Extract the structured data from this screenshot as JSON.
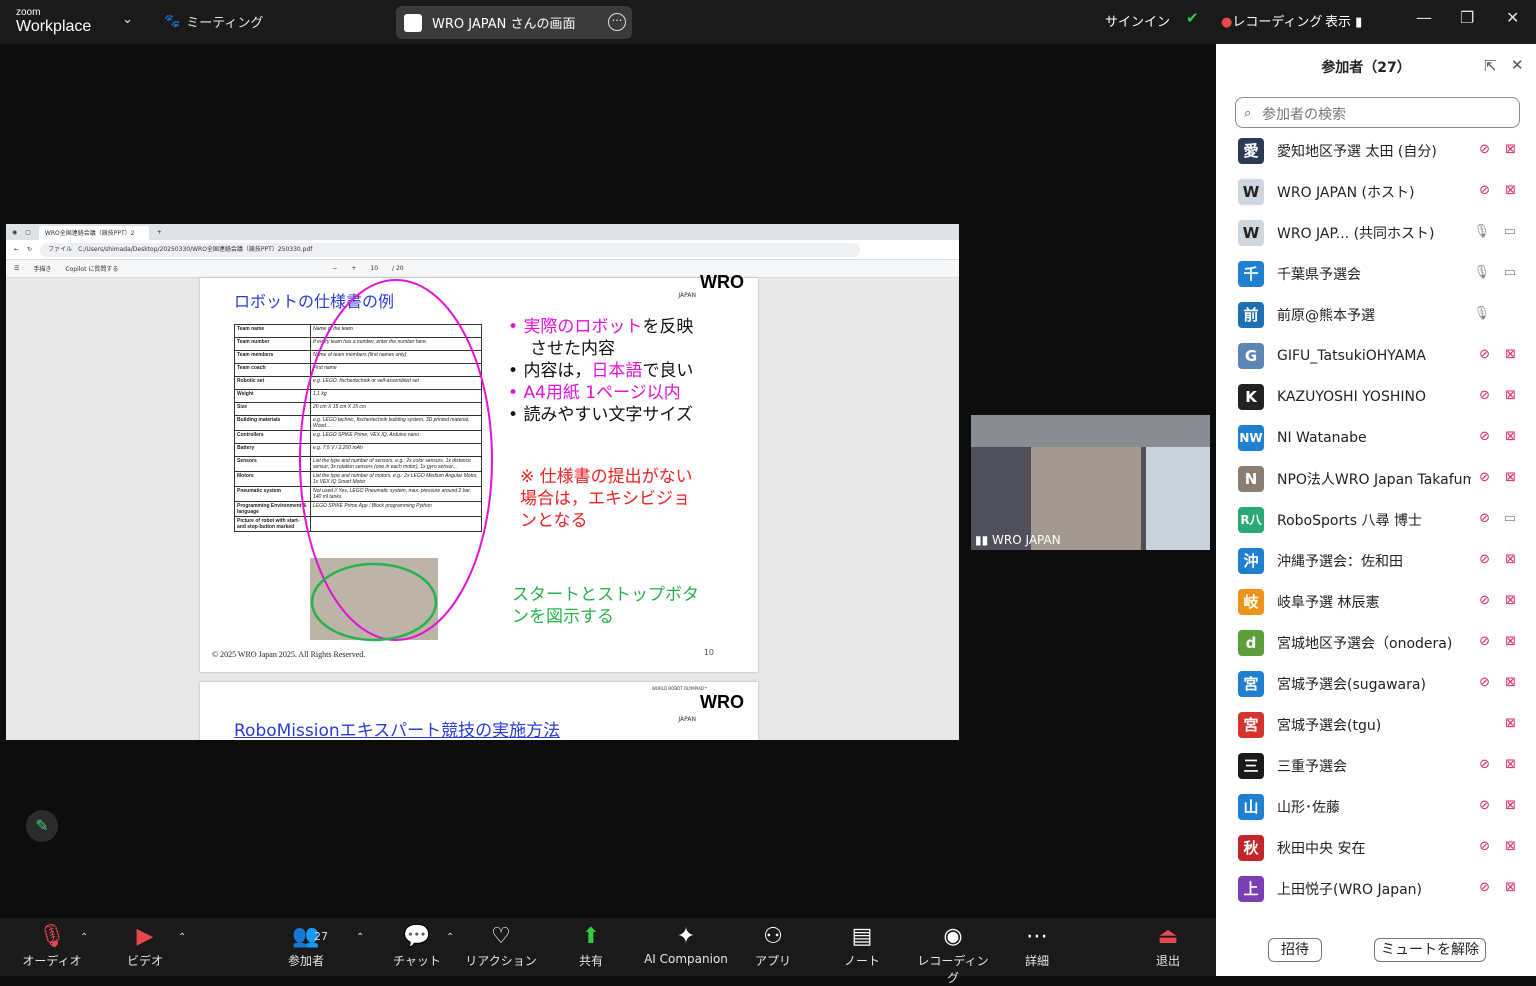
{
  "topbar": {
    "logo_line1": "zoom",
    "logo_line2": "Workplace",
    "meeting_label": "ミーティング",
    "sharing_label": "WRO JAPAN さんの画面",
    "signin": "サインイン",
    "recording": "レコーディング",
    "view": "表示"
  },
  "browser": {
    "tab_title": "WRO全国連絡会議（競技PPT）2",
    "url": "C:/Users/shimada/Desktop/20250330/WRO全国連絡会議（競技PPT）250330.pdf",
    "file_label": "ファイル",
    "page_current": "10",
    "page_total": "/ 20",
    "toolbar_draw": "手描き",
    "copilot": "Copilot に質問する"
  },
  "slide1": {
    "title": "ロボットの仕様書の例",
    "table": [
      {
        "k": "Team name",
        "v": "Name of the team"
      },
      {
        "k": "Team number",
        "v": "If every team has a number, enter the number here."
      },
      {
        "k": "Team members",
        "v": "Name of team members (first names only)"
      },
      {
        "k": "Team coach",
        "v": "First name"
      },
      {
        "k": "Robotic set",
        "v": "e.g. LEGO, fischertechnik or self-assembled set"
      },
      {
        "k": "Weight",
        "v": "1,1 kg"
      },
      {
        "k": "Size",
        "v": "20 cm X 15 cm X 15 cm"
      },
      {
        "k": "Building materials",
        "v": "e.g. LEGO technic, fischertechnik building system, 3D printed material, Wood..."
      },
      {
        "k": "Controllers",
        "v": "e.g. LEGO SPIKE Prime, VEX IQ, Arduino nano"
      },
      {
        "k": "Battery",
        "v": "e.g. 7,5 V / 2.200 mAh"
      },
      {
        "k": "Sensors",
        "v": "List the type and number of sensors, e.g.: 2x color sensors, 1x distance sensor, 3x rotation sensors (one in each motor), 1x gyro sensor..."
      },
      {
        "k": "Motors",
        "v": "List the type and number of motors, e.g.: 2x LEGO Medium Angular Motor, 1x VEX IQ Smart Motor"
      },
      {
        "k": "Pneumatic system",
        "v": "Not used // Yes, LEGO Pneumatic system, max. pressure around 2 bar, 140 ml tanks"
      },
      {
        "k": "Programming Environment & language",
        "v": "LEGO SPIKE Prime App / Block programming Python"
      },
      {
        "k": "Picture of robot with start- and stop-button marked",
        "v": ""
      }
    ],
    "b1_pink": "実際のロボット",
    "b1_rest": "を反映",
    "b1_line2": "させた内容",
    "b2_a": "内容は，",
    "b2_pink": "日本語",
    "b2_b": "で良い",
    "b3_pink": "A4用紙 1ページ以内",
    "b4": "読みやすい文字サイズ",
    "red1": "※ 仕様書の提出がない",
    "red2": "場合は，エキシビジョ",
    "red3": "ンとなる",
    "green1": "スタートとストップボタ",
    "green2": "ンを図示する",
    "copyright": "© 2025 WRO Japan 2025. All Rights Reserved.",
    "page": "10",
    "wro": "WRO",
    "wro_sub": "JAPAN"
  },
  "slide2": {
    "title": "RoboMissionエキスパート競技の実施方法",
    "wro_top": "WORLD ROBOT OLYMPIAD™",
    "wro": "WRO",
    "wro_sub": "JAPAN"
  },
  "video": {
    "name": "WRO JAPAN"
  },
  "panel": {
    "title": "参加者（27）",
    "search_placeholder": "参加者の検索",
    "participants": [
      {
        "name": "愛知地区予選 太田 (自分)",
        "avatar": "愛",
        "color": "#2b3a55",
        "mic": "muted",
        "cam": "off"
      },
      {
        "name": "WRO JAPAN (ホスト)",
        "avatar": "W",
        "color": "#cfd6de",
        "mic": "muted",
        "cam": "off"
      },
      {
        "name": "WRO JAP... (共同ホスト)",
        "avatar": "W",
        "color": "#cfd6de",
        "mic": "on",
        "cam": "on"
      },
      {
        "name": "千葉県予選会",
        "avatar": "千",
        "color": "#1f7fd1",
        "mic": "on",
        "cam": "on"
      },
      {
        "name": "前原@熊本予選",
        "avatar": "前",
        "color": "#1f6fb5",
        "mic": "on",
        "cam": "none"
      },
      {
        "name": "GIFU_TatsukiOHYAMA",
        "avatar": "G",
        "color": "#5b86b5",
        "mic": "muted",
        "cam": "off"
      },
      {
        "name": "KAZUYOSHI YOSHINO",
        "avatar": "K",
        "color": "#222222",
        "mic": "muted",
        "cam": "off"
      },
      {
        "name": "NI Watanabe",
        "avatar": "NW",
        "color": "#1f7fd1",
        "mic": "muted",
        "cam": "off"
      },
      {
        "name": "NPO法人WRO Japan Takafumi...",
        "avatar": "N",
        "color": "#8a7e73",
        "mic": "muted",
        "cam": "off"
      },
      {
        "name": "RoboSports 八尋 博士",
        "avatar": "R八",
        "color": "#2aa876",
        "mic": "muted",
        "cam": "on"
      },
      {
        "name": "沖縄予選会：佐和田",
        "avatar": "沖",
        "color": "#1f7fd1",
        "mic": "muted",
        "cam": "off"
      },
      {
        "name": "岐阜予選 林辰憲",
        "avatar": "岐",
        "color": "#f0931a",
        "mic": "muted",
        "cam": "off"
      },
      {
        "name": "宮城地区予選会（onodera)",
        "avatar": "d",
        "color": "#5e9e3a",
        "mic": "muted",
        "cam": "off"
      },
      {
        "name": "宮城予選会(sugawara)",
        "avatar": "宮",
        "color": "#1f7fd1",
        "mic": "muted",
        "cam": "off"
      },
      {
        "name": "宮城予選会(tgu)",
        "avatar": "宮",
        "color": "#d4342c",
        "mic": "none",
        "cam": "off"
      },
      {
        "name": "三重予選会",
        "avatar": "三",
        "color": "#1a1a1a",
        "mic": "muted",
        "cam": "off"
      },
      {
        "name": "山形･佐藤",
        "avatar": "山",
        "color": "#1f7fd1",
        "mic": "muted",
        "cam": "off"
      },
      {
        "name": "秋田中央 安在",
        "avatar": "秋",
        "color": "#c0262b",
        "mic": "muted",
        "cam": "off"
      },
      {
        "name": "上田悦子(WRO Japan)",
        "avatar": "上",
        "color": "#7b3fb5",
        "mic": "muted",
        "cam": "off"
      }
    ],
    "invite": "招待",
    "unmute_all": "ミュートを解除"
  },
  "bottombar": {
    "audio": "オーディオ",
    "video": "ビデオ",
    "participants": "参加者",
    "participants_count": "27",
    "chat": "チャット",
    "reaction": "リアクション",
    "share": "共有",
    "ai": "AI Companion",
    "apps": "アプリ",
    "notes": "ノート",
    "recording": "レコーディング",
    "more": "詳細",
    "leave": "退出"
  }
}
